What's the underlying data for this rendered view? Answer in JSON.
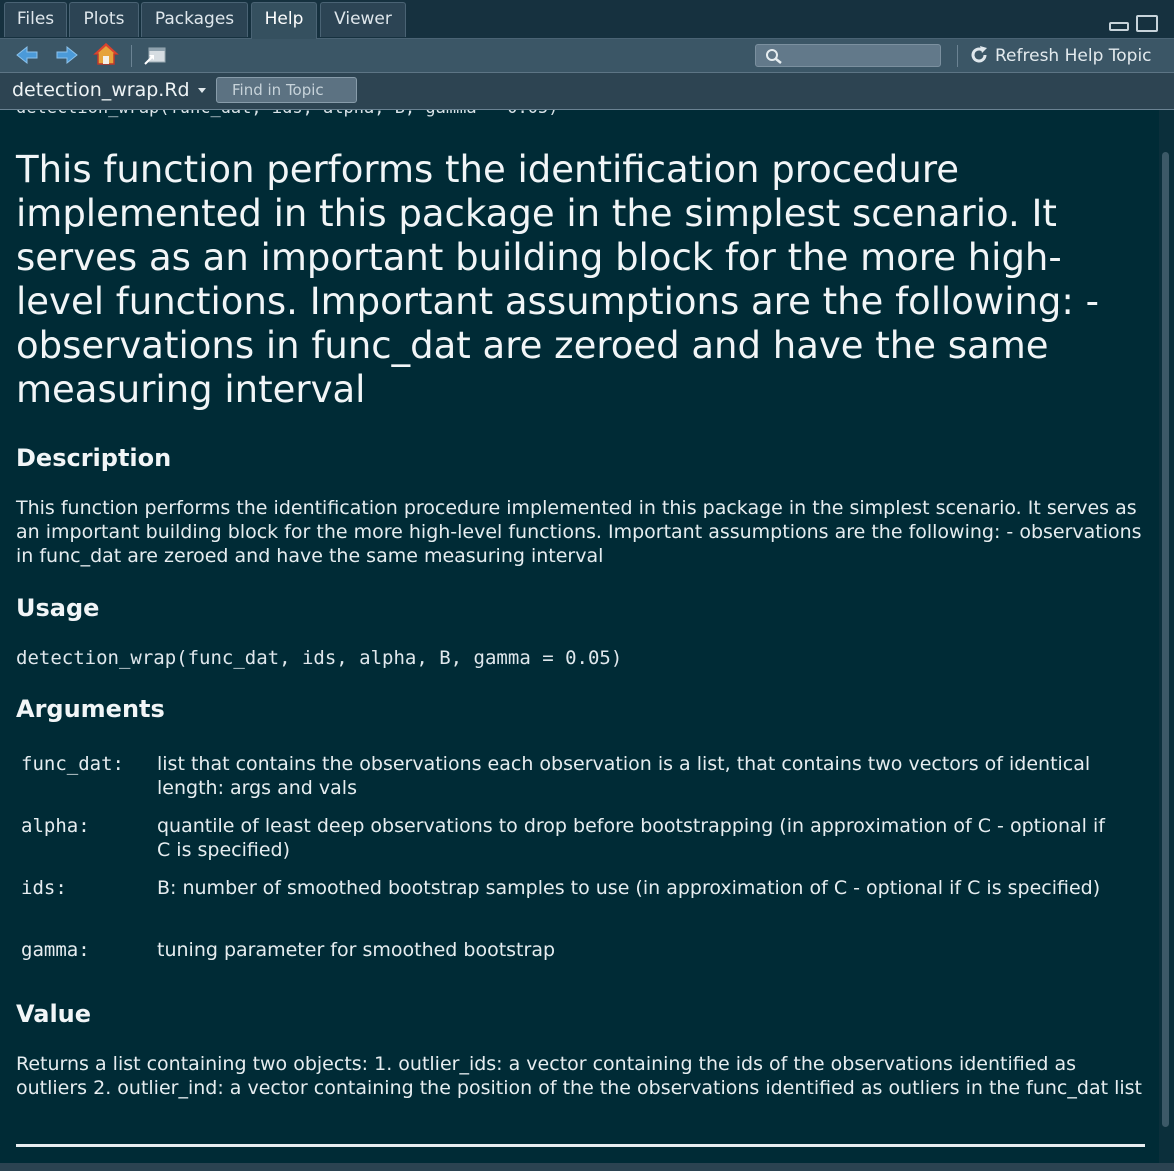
{
  "tabs": [
    {
      "label": "Files"
    },
    {
      "label": "Plots"
    },
    {
      "label": "Packages"
    },
    {
      "label": "Help"
    },
    {
      "label": "Viewer"
    }
  ],
  "toolbar": {
    "refresh_label": "Refresh Help Topic",
    "search_value": ""
  },
  "topic": {
    "current": "detection_wrap.Rd",
    "find_placeholder": "Find in Topic"
  },
  "doc": {
    "clipped_header": "detection_wrap(func_dat, ids, alpha, B, gamma = 0.05)",
    "title": "This function performs the identification procedure implemented in this package in the simplest scenario. It serves as an important building block for the more high-level functions. Important assumptions are the following: - observations in func_dat are zeroed and have the same measuring interval",
    "description_heading": "Description",
    "description_text": "This function performs the identification procedure implemented in this package in the simplest scenario. It serves as an important building block for the more high-level functions. Important assumptions are the following: - observations in func_dat are zeroed and have the same measuring interval",
    "usage_heading": "Usage",
    "usage_code": "detection_wrap(func_dat, ids, alpha, B, gamma = 0.05)",
    "arguments_heading": "Arguments",
    "arguments": [
      {
        "name": "func_dat:",
        "desc": "list that contains the observations each observation is a list, that contains two vectors of identical length: args and vals"
      },
      {
        "name": "alpha:",
        "desc": "quantile of least deep observations to drop before bootstrapping (in approximation of C - optional if C is specified)"
      },
      {
        "name": "ids:",
        "desc": "B: number of smoothed bootstrap samples to use (in approximation of C - optional if C is specified)"
      },
      {
        "name": "gamma:",
        "desc": "tuning parameter for smoothed bootstrap"
      }
    ],
    "value_heading": "Value",
    "value_text": "Returns a list containing two objects: 1. outlier_ids: a vector containing the ids of the observations identified as outliers 2. outlier_ind: a vector containing the position of the the observations identified as outliers in the func_dat list"
  }
}
